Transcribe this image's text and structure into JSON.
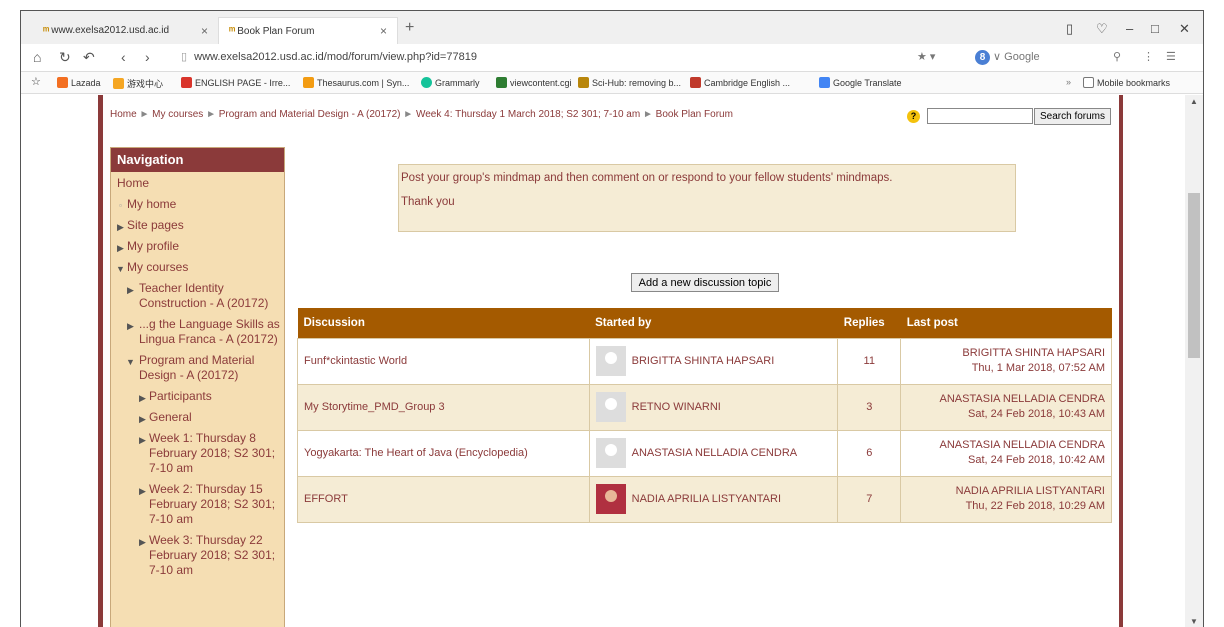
{
  "tabs": [
    {
      "title": "www.exelsa2012.usd.ac.id"
    },
    {
      "title": "Book Plan Forum"
    }
  ],
  "address": {
    "url": "www.exelsa2012.usd.ac.id/mod/forum/view.php?id=77819",
    "search_engine": "Google"
  },
  "bookmarks": [
    {
      "label": "Lazada",
      "color": "#f36f21"
    },
    {
      "label": "游戏中心",
      "color": "#f5a623"
    },
    {
      "label": "ENGLISH PAGE - Irre...",
      "color": "#d9342b"
    },
    {
      "label": "Thesaurus.com | Syn...",
      "color": "#f39c12"
    },
    {
      "label": "Grammarly",
      "color": "#15c39a"
    },
    {
      "label": "viewcontent.cgi",
      "color": "#2e7d32"
    },
    {
      "label": "Sci-Hub: removing b...",
      "color": "#b8860b"
    },
    {
      "label": "Cambridge English ...",
      "color": "#c0392b"
    },
    {
      "label": "Google Translate",
      "color": "#4285f4"
    }
  ],
  "mobile_bookmarks": "Mobile bookmarks",
  "breadcrumb": {
    "home": "Home",
    "my_courses": "My courses",
    "course": "Program and Material Design - A (20172)",
    "week": "Week 4: Thursday 1 March 2018; S2 301; 7-10 am",
    "forum": "Book Plan Forum"
  },
  "search": {
    "button": "Search forums"
  },
  "navigation": {
    "title": "Navigation",
    "home": "Home",
    "my_home": "My home",
    "site_pages": "Site pages",
    "my_profile": "My profile",
    "my_courses": "My courses",
    "course1": "Teacher Identity Construction - A (20172)",
    "course2": "...g the Language Skills as Lingua Franca - A (20172)",
    "course3": "Program and Material Design - A (20172)",
    "participants": "Participants",
    "general": "General",
    "week1": "Week 1: Thursday 8 February 2018; S2 301; 7-10 am",
    "week2": "Week 2: Thursday 15 February 2018; S2 301; 7-10 am",
    "week3": "Week 3: Thursday 22 February 2018; S2 301; 7-10 am"
  },
  "intro": {
    "line1": "Post your group's mindmap and then comment on or respond to your fellow students' mindmaps.",
    "line2": "Thank you"
  },
  "add_topic": "Add a new discussion topic",
  "table": {
    "headers": {
      "discussion": "Discussion",
      "started_by": "Started by",
      "replies": "Replies",
      "last_post": "Last post"
    },
    "rows": [
      {
        "discussion": "Funf*ckintastic World",
        "started_by": "BRIGITTA SHINTA HAPSARI",
        "replies": "11",
        "last_name": "BRIGITTA SHINTA HAPSARI",
        "last_date": "Thu, 1 Mar 2018, 07:52 AM"
      },
      {
        "discussion": "My Storytime_PMD_Group 3",
        "started_by": "RETNO WINARNI",
        "replies": "3",
        "last_name": "ANASTASIA NELLADIA CENDRA",
        "last_date": "Sat, 24 Feb 2018, 10:43 AM"
      },
      {
        "discussion": "Yogyakarta: The Heart of Java (Encyclopedia)",
        "started_by": "ANASTASIA NELLADIA CENDRA",
        "replies": "6",
        "last_name": "ANASTASIA NELLADIA CENDRA",
        "last_date": "Sat, 24 Feb 2018, 10:42 AM"
      },
      {
        "discussion": "EFFORT",
        "started_by": "NADIA APRILIA LISTYANTARI",
        "replies": "7",
        "last_name": "NADIA APRILIA LISTYANTARI",
        "last_date": "Thu, 22 Feb 2018, 10:29 AM"
      }
    ]
  },
  "colors": {
    "theme": "#8b3a3a",
    "header": "#a45a00",
    "nav_bg": "#f5deb3"
  }
}
